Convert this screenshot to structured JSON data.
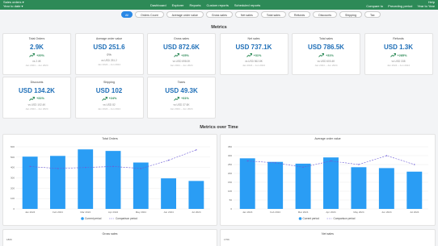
{
  "topbar": {
    "app_name": "Sales orders",
    "period": "Year to date",
    "nav": [
      "Dashboard",
      "Explorer",
      "Reports",
      "Custom reports",
      "Scheduled reports"
    ],
    "help": "Help",
    "compare_to": "Compare to",
    "compare_value": "Preceding period",
    "range_value": "Year to Year"
  },
  "filters": [
    "All",
    "Orders Count",
    "Average order value",
    "Gross sales",
    "Net sales",
    "Total sales",
    "Refunds",
    "Discounts",
    "Shipping",
    "Tax"
  ],
  "metrics_title": "Metrics",
  "cards": [
    {
      "label": "Total Orders",
      "value": "2.9K",
      "change": "+20%",
      "cmp": "vs 2.4K",
      "period": "Jan 2024 – Jun 2024",
      "trend": "up"
    },
    {
      "label": "Average order value",
      "value": "USD 251.6",
      "change": "0%",
      "cmp": "vs USD 251.2",
      "period": "Jan 2024 – Jun 2024",
      "trend": "flat"
    },
    {
      "label": "Gross sales",
      "value": "USD 872.6K",
      "change": "+25%",
      "cmp": "vs USD 698.0K",
      "period": "Jan 2024 – Jun 2024",
      "trend": "up"
    },
    {
      "label": "Net sales",
      "value": "USD 737.1K",
      "change": "+31%",
      "cmp": "vs USD 562.8K",
      "period": "Jan 2024 – Jun 2024",
      "trend": "up"
    },
    {
      "label": "Total sales",
      "value": "USD 786.5K",
      "change": "+31%",
      "cmp": "vs USD 600.4K",
      "period": "Jan 2024 – Jun 2024",
      "trend": "up"
    },
    {
      "label": "Refunds",
      "value": "USD 1.3K",
      "change": "+285%",
      "cmp": "vs USD 338",
      "period": "Jan 2024 – Jun 2024",
      "trend": "up"
    },
    {
      "label": "Discounts",
      "value": "USD 134.2K",
      "change": "+31%",
      "cmp": "vs USD 102.4K",
      "period": "Jan 2024 – Jun 2024",
      "trend": "up"
    },
    {
      "label": "Shipping",
      "value": "USD 102",
      "change": "+24%",
      "cmp": "vs USD 82",
      "period": "Jan 2024 – Jun 2024",
      "trend": "up"
    },
    {
      "label": "Taxes",
      "value": "USD 49.3K",
      "change": "+31%",
      "cmp": "vs USD 37.6K",
      "period": "Jan 2024 – Jun 2024",
      "trend": "up"
    }
  ],
  "over_time_title": "Metrics over Time",
  "chart_data": [
    {
      "type": "bar",
      "title": "Total Orders",
      "categories": [
        "Jan 2024",
        "Feb 2024",
        "Mar 2024",
        "Apr 2024",
        "May 2024",
        "Jun 2024",
        "Jul 2024"
      ],
      "ylim": [
        0,
        600
      ],
      "yticks": [
        "0",
        "100",
        "200",
        "300",
        "400",
        "500",
        "600"
      ],
      "series": [
        {
          "name": "Current period",
          "values": [
            505,
            512,
            575,
            560,
            448,
            295,
            270
          ]
        },
        {
          "name": "Comparison period",
          "values": [
            410,
            390,
            400,
            410,
            390,
            470,
            570
          ]
        }
      ]
    },
    {
      "type": "bar",
      "title": "Average order value",
      "categories": [
        "Jan 2024",
        "Feb 2024",
        "Mar 2024",
        "Apr 2024",
        "May 2024",
        "Jun 2024",
        "Jul 2024"
      ],
      "ylim": [
        0,
        350
      ],
      "yticks": [
        "0",
        "50",
        "100",
        "150",
        "200",
        "250",
        "300",
        "350"
      ],
      "series": [
        {
          "name": "Current period",
          "values": [
            285,
            265,
            255,
            290,
            235,
            230,
            210
          ]
        },
        {
          "name": "Comparison period",
          "values": [
            270,
            260,
            235,
            270,
            250,
            300,
            250
          ]
        }
      ]
    }
  ],
  "bottom_charts": [
    {
      "title": "Gross sales",
      "top_tick": "180K"
    },
    {
      "title": "Net sales",
      "top_tick": "175K"
    }
  ],
  "colors": {
    "topbar": "#2d8a57",
    "bar": "#2a9df4",
    "line": "#6b5bd6",
    "value": "#1f6fb8",
    "positive": "#2d8a57"
  }
}
